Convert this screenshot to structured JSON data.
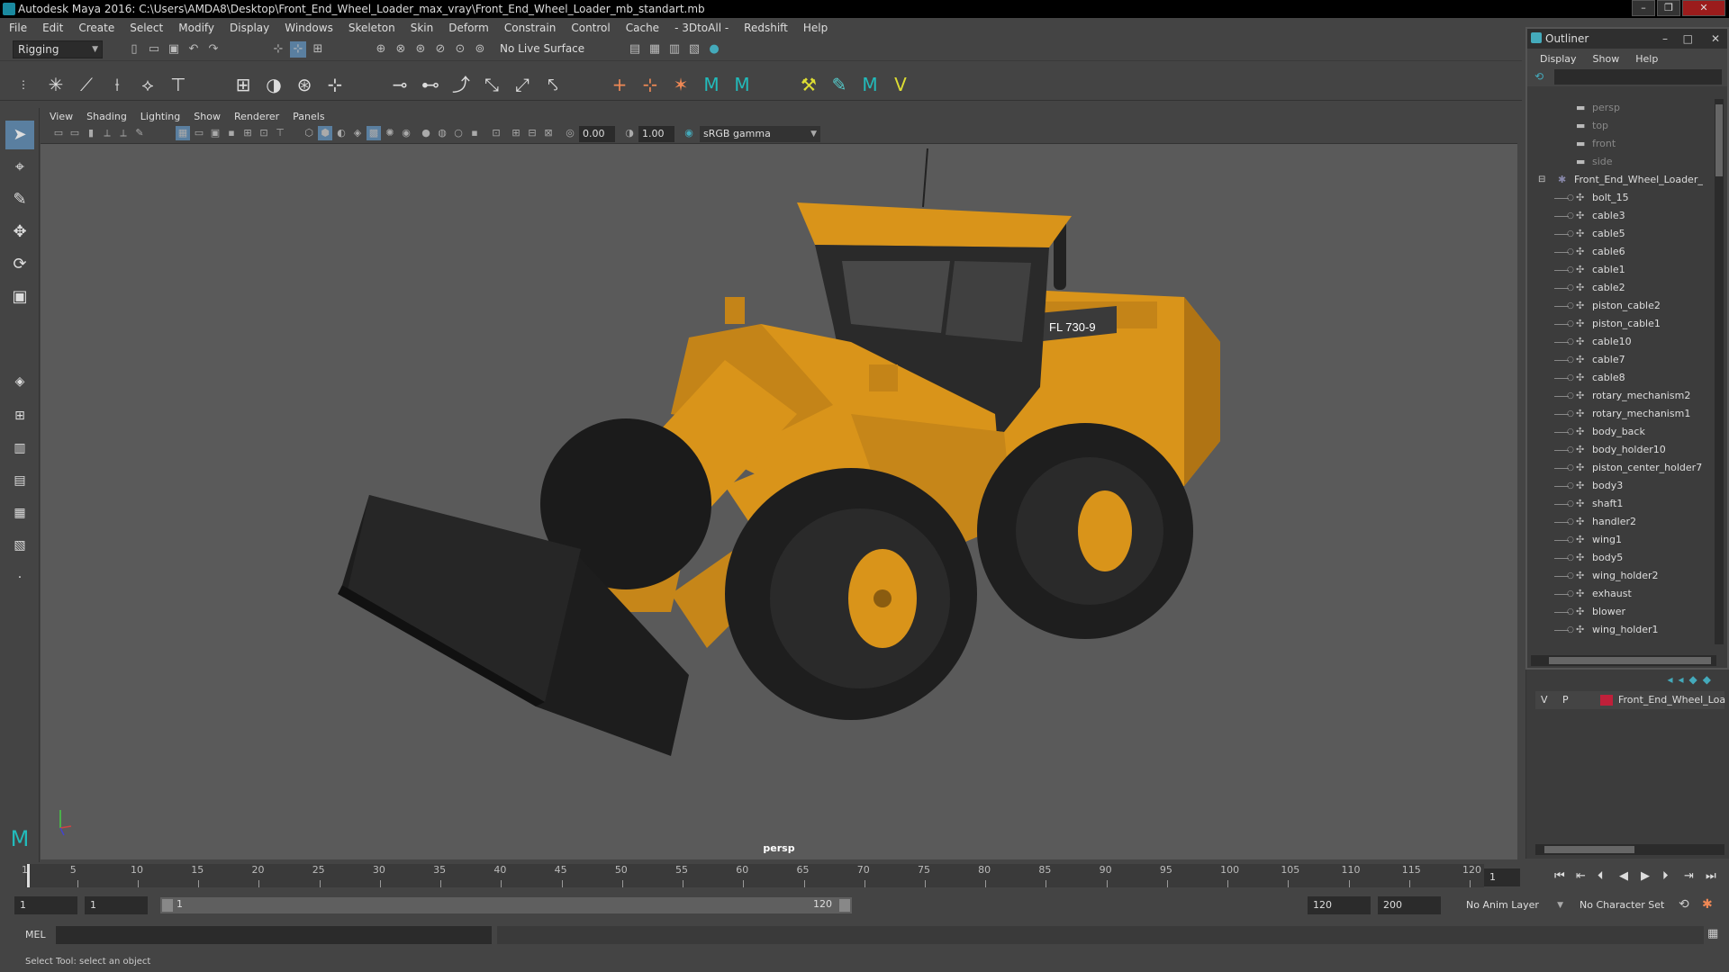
{
  "window": {
    "title": "Autodesk Maya 2016: C:\\Users\\AMDA8\\Desktop\\Front_End_Wheel_Loader_max_vray\\Front_End_Wheel_Loader_mb_standart.mb"
  },
  "menubar": [
    "File",
    "Edit",
    "Create",
    "Select",
    "Modify",
    "Display",
    "Windows",
    "Skeleton",
    "Skin",
    "Deform",
    "Constrain",
    "Control",
    "Cache",
    "- 3DtoAll -",
    "Redshift",
    "Help"
  ],
  "statusline": {
    "menuset": "Rigging",
    "live_surface": "No Live Surface"
  },
  "panel": {
    "menus": [
      "View",
      "Shading",
      "Lighting",
      "Show",
      "Renderer",
      "Panels"
    ],
    "exposure": "0.00",
    "gamma": "1.00",
    "color_space": "sRGB gamma",
    "camera_label": "persp",
    "model_badge": "FL 730-9"
  },
  "outliner": {
    "title": "Outliner",
    "menus": [
      "Display",
      "Show",
      "Help"
    ],
    "cameras": [
      "persp",
      "top",
      "front",
      "side"
    ],
    "root": "Front_End_Wheel_Loader_",
    "items": [
      "bolt_15",
      "cable3",
      "cable5",
      "cable6",
      "cable1",
      "cable2",
      "piston_cable2",
      "piston_cable1",
      "cable10",
      "cable7",
      "cable8",
      "rotary_mechanism2",
      "rotary_mechanism1",
      "body_back",
      "body_holder10",
      "piston_center_holder7",
      "body3",
      "shaft1",
      "handler2",
      "wing1",
      "body5",
      "wing_holder2",
      "exhaust",
      "blower",
      "wing_holder1"
    ]
  },
  "layers": {
    "v": "V",
    "p": "P",
    "name": "Front_End_Wheel_Loa",
    "color": "#c0203a"
  },
  "timeline": {
    "ticks": [
      "1",
      "5",
      "10",
      "15",
      "20",
      "25",
      "30",
      "35",
      "40",
      "45",
      "50",
      "55",
      "60",
      "65",
      "70",
      "75",
      "80",
      "85",
      "90",
      "95",
      "100",
      "105",
      "110",
      "115",
      "120"
    ],
    "current_frame": "1"
  },
  "range": {
    "start": "1",
    "playback_start": "1",
    "slider_start": "1",
    "slider_end": "120",
    "playback_end": "120",
    "end": "200",
    "anim_layer": "No Anim Layer",
    "char_set": "No Character Set"
  },
  "cmdline": {
    "lang": "MEL"
  },
  "helpline": "Select Tool: select an object",
  "colors": {
    "loader_yellow": "#d9941a",
    "viewport_bg": "#5a5a5a",
    "accent": "#1a8aa0"
  }
}
